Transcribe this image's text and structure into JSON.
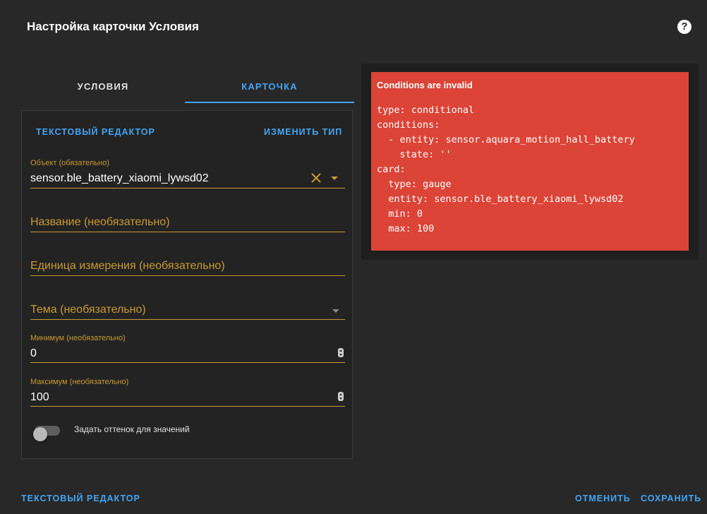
{
  "dialog": {
    "title": "Настройка карточки Условия",
    "help_icon": "help-circle-icon",
    "help_glyph": "?"
  },
  "tabs": [
    {
      "label": "УСЛОВИЯ",
      "active": false
    },
    {
      "label": "КАРТОЧКА",
      "active": true
    }
  ],
  "editor": {
    "text_editor_label": "ТЕКСТОВЫЙ РЕДАКТОР",
    "change_type_label": "ИЗМЕНИТЬ ТИП",
    "entity": {
      "label": "Объект (обязательно)",
      "value": "sensor.ble_battery_xiaomi_lywsd02"
    },
    "name": {
      "placeholder": "Название (необязательно)"
    },
    "unit": {
      "placeholder": "Единица измерения (необязательно)"
    },
    "theme": {
      "placeholder": "Тема (необязательно)"
    },
    "min": {
      "label": "Минимум (необязательно)",
      "value": "0"
    },
    "max": {
      "label": "Максимум (необязательно)",
      "value": "100"
    },
    "severity_toggle": {
      "label": "Задать оттенок для значений",
      "checked": false
    }
  },
  "preview": {
    "error_title": "Conditions are invalid",
    "error_code": "type: conditional\nconditions:\n  - entity: sensor.aquara_motion_hall_battery\n    state: ''\ncard:\n  type: gauge\n  entity: sensor.ble_battery_xiaomi_lywsd02\n  min: 0\n  max: 100",
    "error_color": "#db4437"
  },
  "footer": {
    "text_editor_label": "ТЕКСТОВЫЙ РЕДАКТОР",
    "cancel_label": "ОТМЕНИТЬ",
    "save_label": "СОХРАНИТЬ"
  },
  "colors": {
    "accent": "#42a5f5",
    "field_accent": "#c99a31",
    "background": "#282828"
  }
}
